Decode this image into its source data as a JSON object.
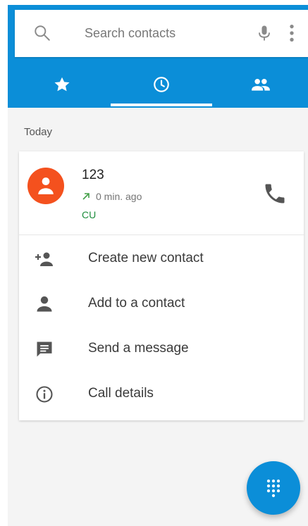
{
  "search": {
    "placeholder": "Search contacts"
  },
  "tabs": [
    {
      "id": "favorites",
      "icon": "star-icon",
      "selected": false
    },
    {
      "id": "recents",
      "icon": "clock-icon",
      "selected": true
    },
    {
      "id": "contacts",
      "icon": "people-icon",
      "selected": false
    }
  ],
  "section": {
    "today_label": "Today"
  },
  "call_entry": {
    "name": "123",
    "time": "0 min. ago",
    "sim": "CU",
    "call_icon": "phone-icon"
  },
  "actions": [
    {
      "label": "Create new contact",
      "icon": "person-add-icon"
    },
    {
      "label": "Add to a contact",
      "icon": "person-icon"
    },
    {
      "label": "Send a message",
      "icon": "message-icon"
    },
    {
      "label": "Call details",
      "icon": "info-icon"
    }
  ],
  "fab": {
    "icon": "dialpad-icon"
  },
  "colors": {
    "primary": "#0b8ed8",
    "avatar": "#f4511e",
    "sim_label": "#1e8e3e",
    "outgoing_arrow": "#43a047"
  }
}
